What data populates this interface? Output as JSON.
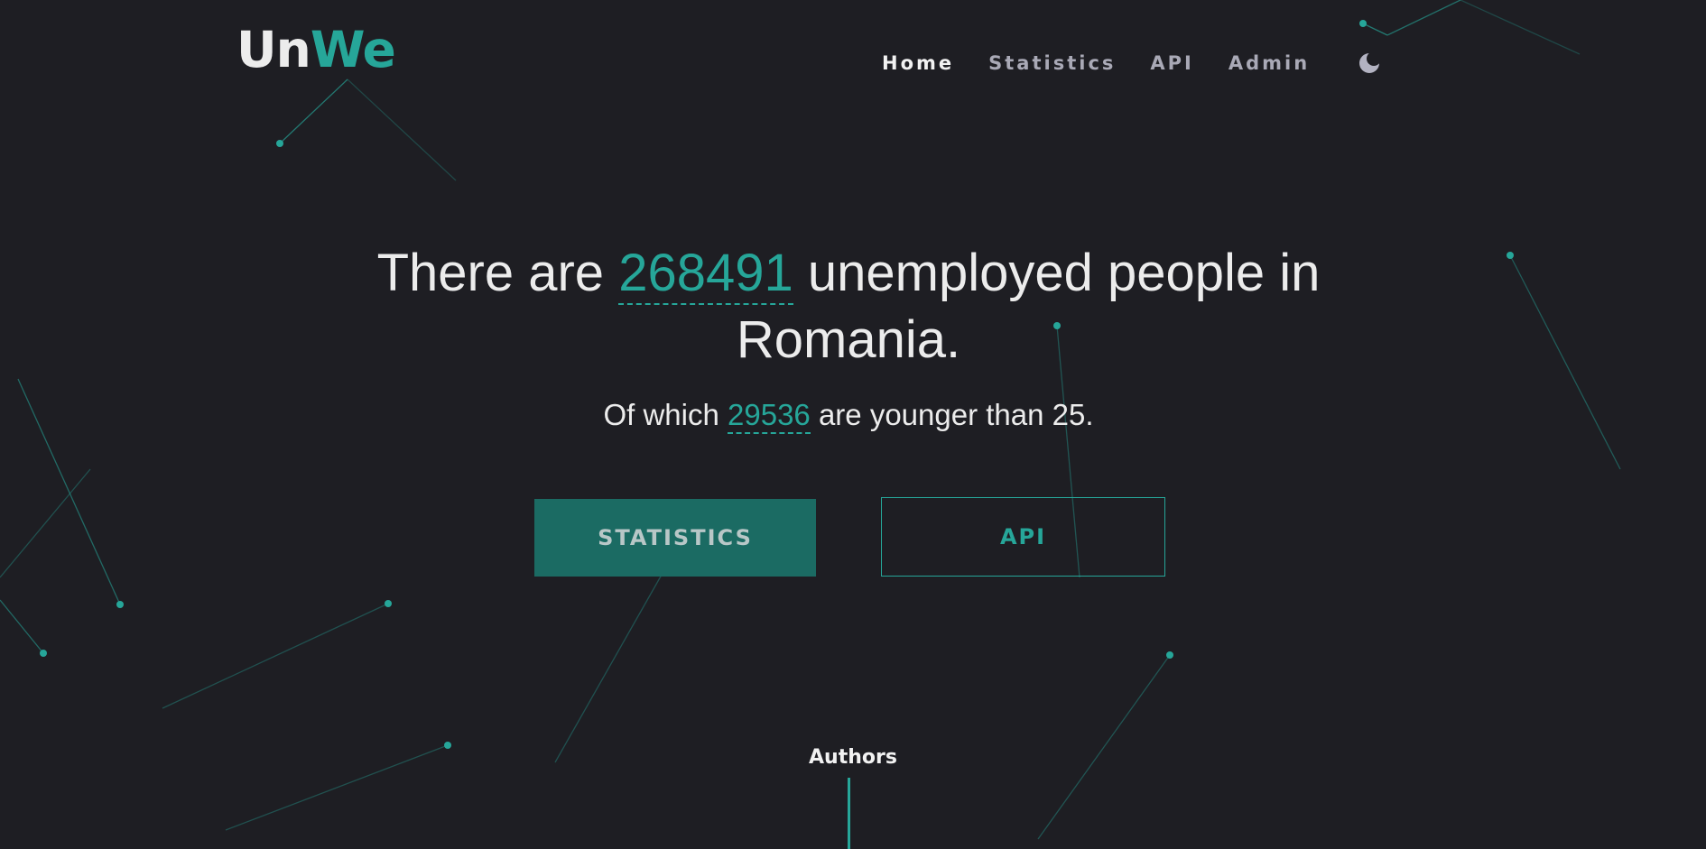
{
  "logo": {
    "part1": "Un",
    "part2": "We"
  },
  "nav": {
    "items": [
      {
        "label": "Home",
        "active": true
      },
      {
        "label": "Statistics",
        "active": false
      },
      {
        "label": "API",
        "active": false
      },
      {
        "label": "Admin",
        "active": false
      }
    ],
    "theme_toggle_icon": "moon-icon"
  },
  "hero": {
    "title_prefix": "There are",
    "unemployed_count": "268491",
    "title_suffix": "unemployed people in Romania.",
    "sub_prefix": "Of which",
    "young_count": "29536",
    "sub_suffix": "are younger than 25."
  },
  "buttons": {
    "statistics": "STATISTICS",
    "api": "API"
  },
  "footer": {
    "authors_label": "Authors"
  },
  "colors": {
    "background": "#1e1e23",
    "accent": "#26a699",
    "button_fill": "#1b6b63",
    "text": "#ececec",
    "nav_inactive": "#a9a9b6"
  }
}
